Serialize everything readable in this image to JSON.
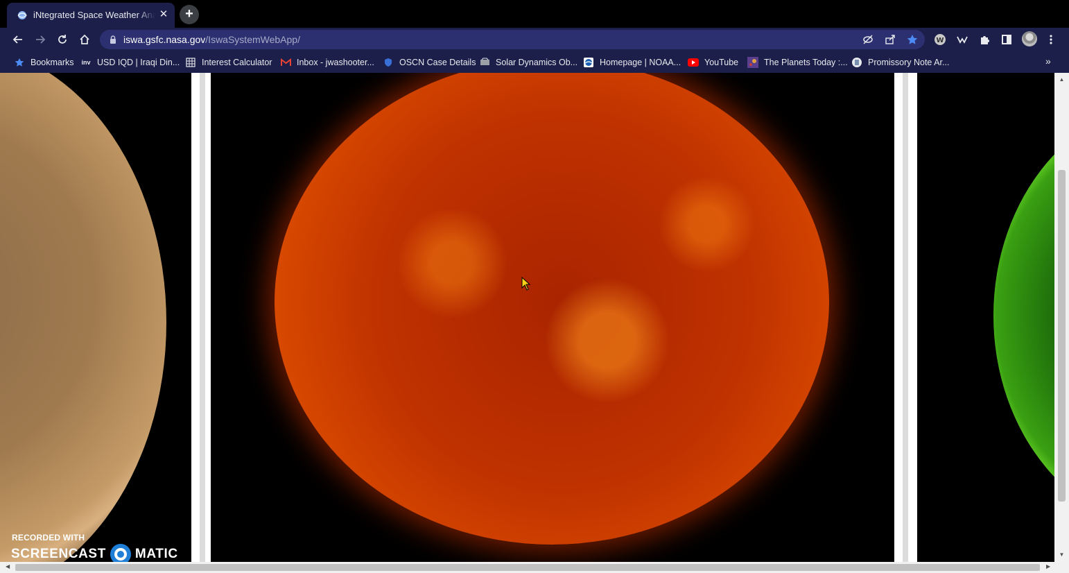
{
  "tab": {
    "title": "iNtegrated Space Weather Analysis",
    "close_glyph": "✕",
    "new_tab_glyph": "+"
  },
  "toolbar": {
    "url_host": "iswa.gsfc.nasa.gov",
    "url_path": "/IswaSystemWebApp/"
  },
  "bookmarks": {
    "items": [
      {
        "label": "Bookmarks",
        "icon": "star-icon"
      },
      {
        "label": "USD IQD | Iraqi Din...",
        "icon": "investing-icon"
      },
      {
        "label": "Interest Calculator",
        "icon": "calculator-icon"
      },
      {
        "label": "Inbox - jwashooter...",
        "icon": "gmail-icon"
      },
      {
        "label": "OSCN Case Details",
        "icon": "oscn-icon"
      },
      {
        "label": "Solar Dynamics Ob...",
        "icon": "sdo-icon"
      },
      {
        "label": "Homepage | NOAA...",
        "icon": "noaa-icon"
      },
      {
        "label": "YouTube",
        "icon": "youtube-icon"
      },
      {
        "label": "The Planets Today :...",
        "icon": "planets-icon"
      },
      {
        "label": "Promissory Note Ar...",
        "icon": "document-icon"
      }
    ],
    "more_glyph": "»"
  },
  "watermark": {
    "line1": "RECORDED WITH",
    "brand_left": "SCREENCAST",
    "brand_right": "MATIC"
  },
  "colors": {
    "chrome_bg": "#1b1f4a",
    "omnibox_bg": "#2c3070",
    "accent_star": "#4c8bf5"
  }
}
